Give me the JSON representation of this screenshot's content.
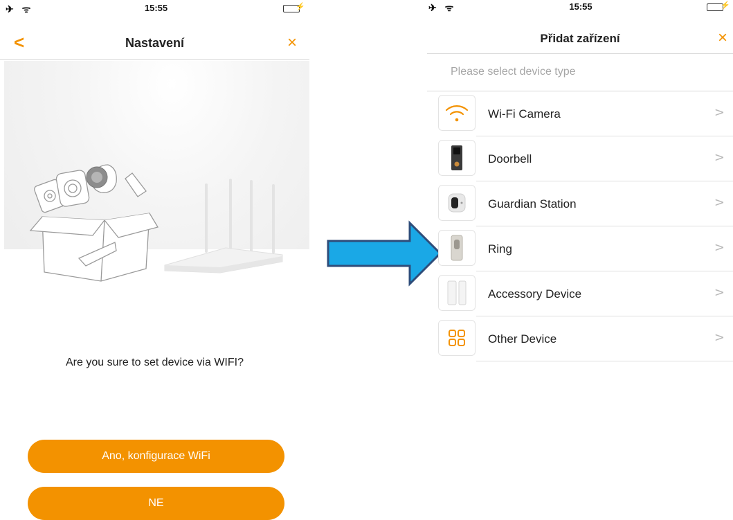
{
  "left_screen": {
    "status": {
      "time": "15:55"
    },
    "navbar": {
      "title": "Nastavení",
      "back_symbol": "<",
      "close_symbol": "×"
    },
    "question": "Are you sure to set device via WIFI?",
    "buttons": {
      "yes": "Ano, konfigurace WiFi",
      "no": "NE"
    }
  },
  "right_screen": {
    "status": {
      "time": "15:55"
    },
    "navbar": {
      "title": "Přidat zařízení",
      "close_symbol": "×"
    },
    "hint": "Please select device type",
    "devices": [
      {
        "label": "Wi-Fi Camera",
        "icon": "wifi-icon"
      },
      {
        "label": "Doorbell",
        "icon": "doorbell-icon"
      },
      {
        "label": "Guardian Station",
        "icon": "guardian-station-icon"
      },
      {
        "label": "Ring",
        "icon": "ring-icon"
      },
      {
        "label": "Accessory Device",
        "icon": "accessory-device-icon"
      },
      {
        "label": "Other Device",
        "icon": "grid-icon"
      }
    ],
    "chevron": ">"
  },
  "colors": {
    "accent": "#f39200",
    "arrow_fill": "#1aa8e6",
    "arrow_stroke": "#2f4d7a",
    "battery": "#4cd964"
  }
}
